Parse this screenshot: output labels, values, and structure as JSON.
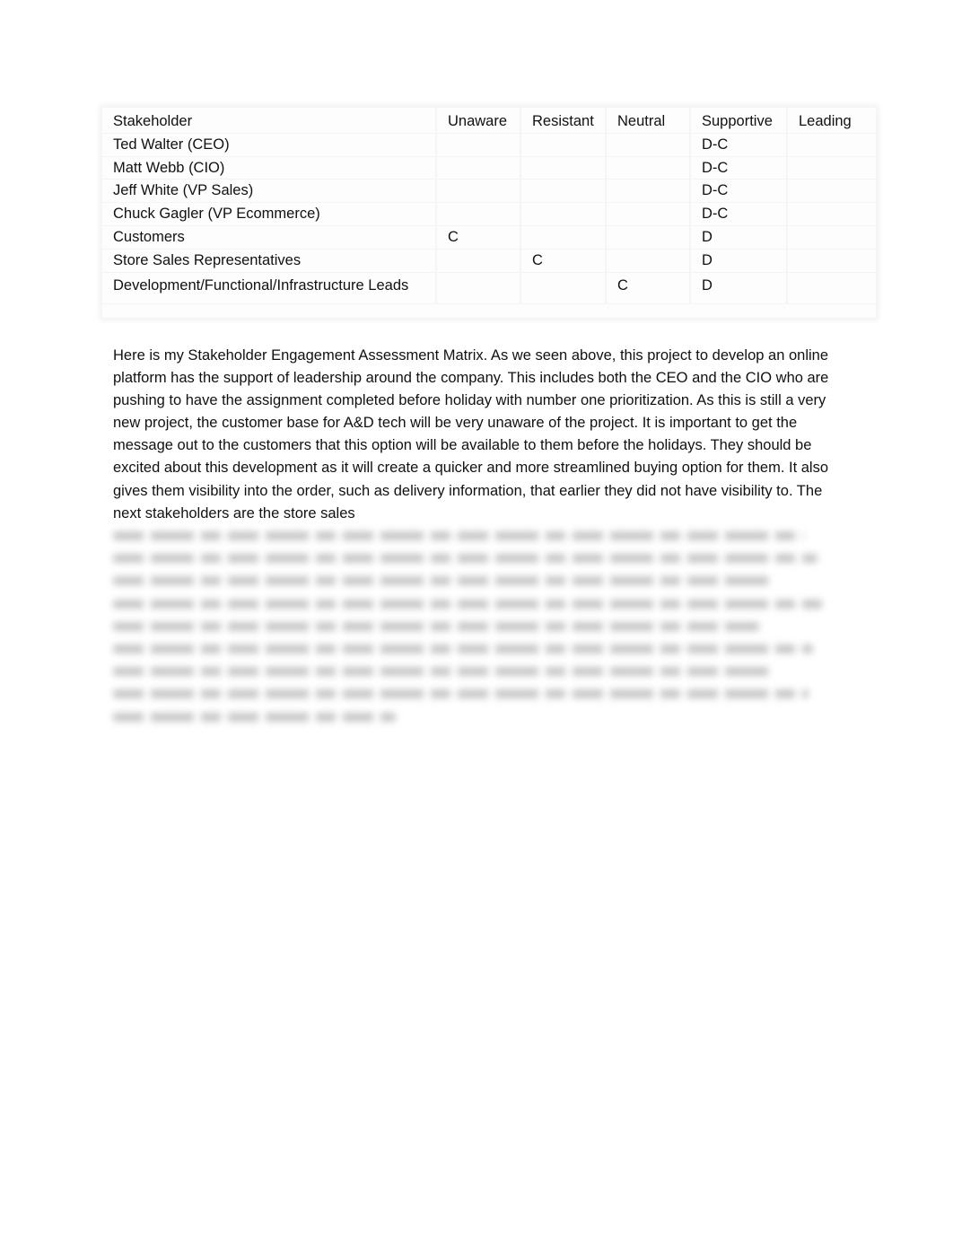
{
  "matrix": {
    "headers": [
      "Stakeholder",
      "Unaware",
      "Resistant",
      "Neutral",
      "Supportive",
      "Leading"
    ],
    "rows": [
      {
        "stakeholder": "Ted Walter (CEO)",
        "unaware": "",
        "resistant": "",
        "neutral": "",
        "supportive": "D-C",
        "leading": ""
      },
      {
        "stakeholder": "Matt Webb (CIO)",
        "unaware": "",
        "resistant": "",
        "neutral": "",
        "supportive": "D-C",
        "leading": ""
      },
      {
        "stakeholder": "Jeff White (VP Sales)",
        "unaware": "",
        "resistant": "",
        "neutral": "",
        "supportive": "D-C",
        "leading": ""
      },
      {
        "stakeholder": "Chuck Gagler (VP Ecommerce)",
        "unaware": "",
        "resistant": "",
        "neutral": "",
        "supportive": "D-C",
        "leading": ""
      },
      {
        "stakeholder": "Customers",
        "unaware": "C",
        "resistant": "",
        "neutral": "",
        "supportive": "D",
        "leading": ""
      },
      {
        "stakeholder": "Store Sales Representatives",
        "unaware": "",
        "resistant": "C",
        "neutral": "",
        "supportive": "D",
        "leading": ""
      },
      {
        "stakeholder": "Development/Functional/Infrastructure Leads",
        "unaware": "",
        "resistant": "",
        "neutral": "C",
        "supportive": "D",
        "leading": ""
      }
    ]
  },
  "paragraph": {
    "visible_text": "Here is my Stakeholder Engagement Assessment Matrix. As we seen above, this project to develop an online platform has the support of leadership around the company. This includes both the CEO and the CIO who are pushing to have the assignment completed before holiday with number one prioritization. As this is still a very new project, the customer base for A&D tech will be very unaware of the project. It is important to get the message out to the customers that this option will be available to them before the holidays. They should be excited about this development as it will create a quicker and more streamlined buying option for them. It also gives them visibility into the order, such as delivery information, that earlier they did not have visibility to. The next stakeholders are the store sales",
    "blurred_line_count": 9
  }
}
